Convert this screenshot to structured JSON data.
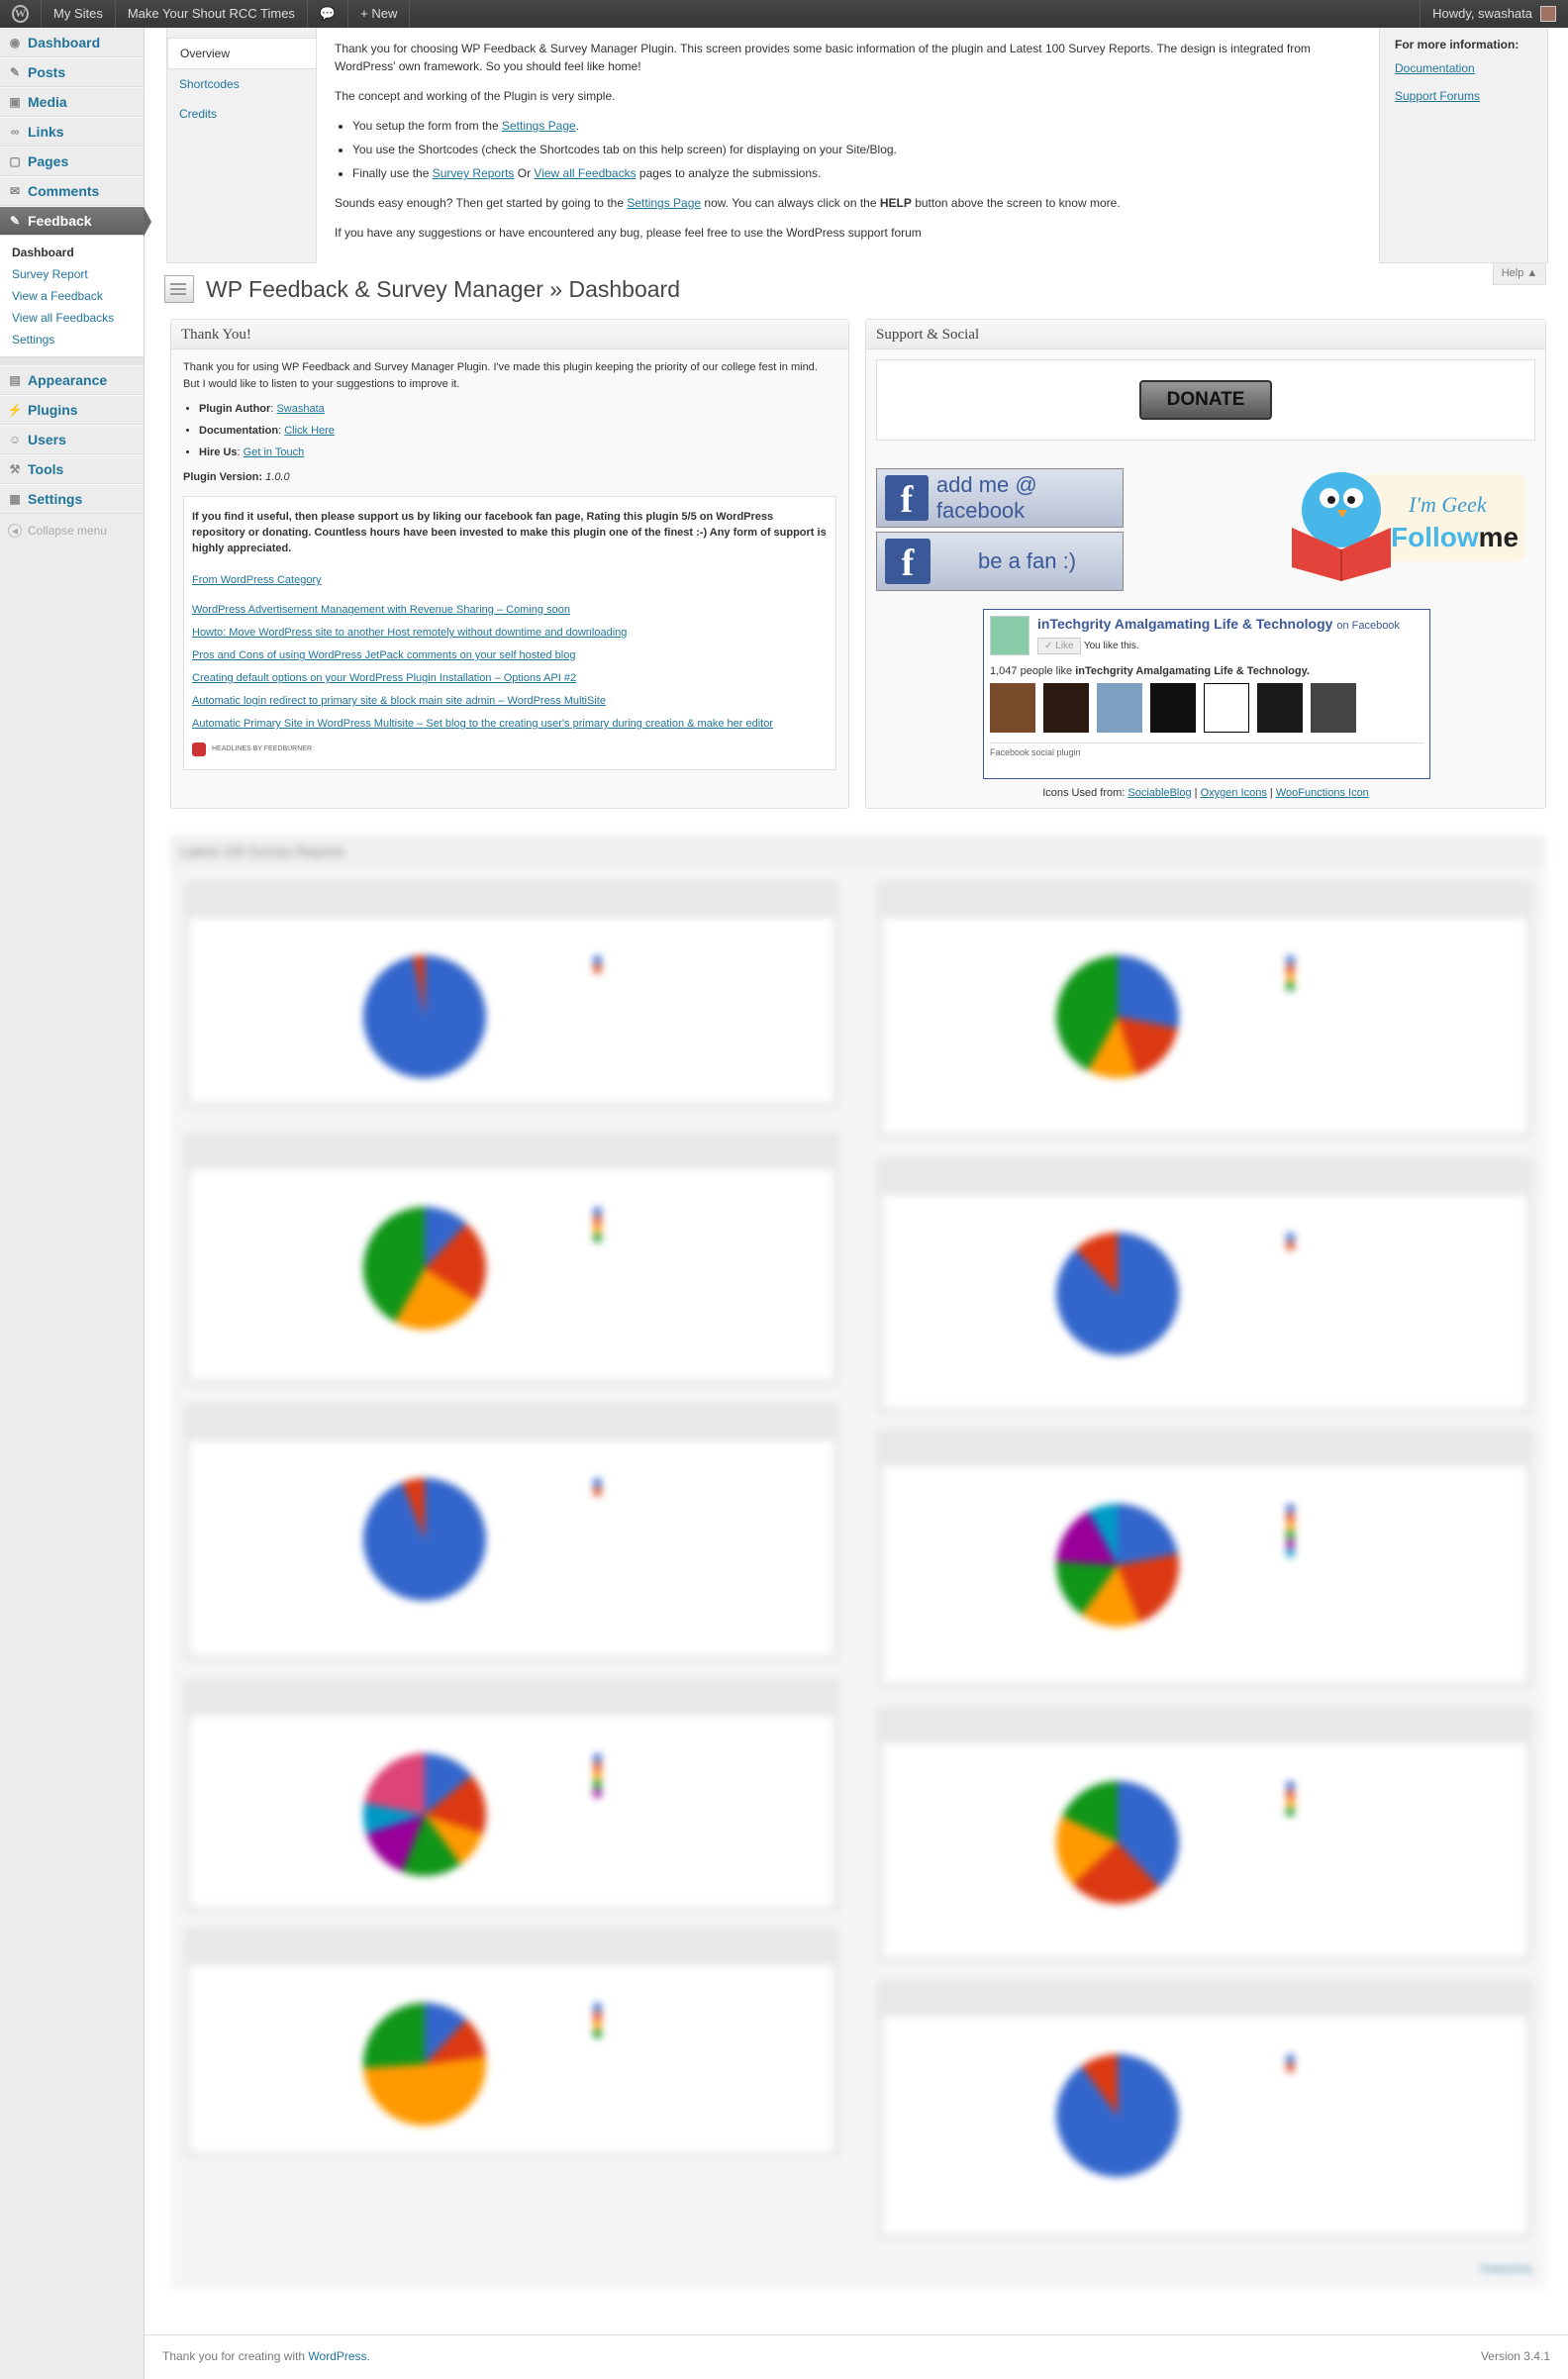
{
  "adminbar": {
    "my_sites": "My Sites",
    "site": "Make Your Shout RCC Times",
    "new": "New",
    "howdy": "Howdy, swashata"
  },
  "menu": {
    "items_top": [
      {
        "label": "Dashboard",
        "icon": "dashboard-icon"
      },
      {
        "label": "Posts",
        "icon": "pin-icon"
      },
      {
        "label": "Media",
        "icon": "media-icon"
      },
      {
        "label": "Links",
        "icon": "link-icon"
      },
      {
        "label": "Pages",
        "icon": "page-icon"
      },
      {
        "label": "Comments",
        "icon": "comment-icon"
      }
    ],
    "active": "Feedback",
    "submenu": [
      "Dashboard",
      "Survey Report",
      "View a Feedback",
      "View all Feedbacks",
      "Settings"
    ],
    "items_bottom": [
      {
        "label": "Appearance"
      },
      {
        "label": "Plugins"
      },
      {
        "label": "Users"
      },
      {
        "label": "Tools"
      },
      {
        "label": "Settings"
      }
    ],
    "collapse": "Collapse menu"
  },
  "help": {
    "tabs": [
      "Overview",
      "Shortcodes",
      "Credits"
    ],
    "p1": "Thank you for choosing WP Feedback & Survey Manager Plugin. This screen provides some basic information of the plugin and Latest 100 Survey Reports. The design is integrated from WordPress' own framework. So you should feel like home!",
    "p2": "The concept and working of the Plugin is very simple.",
    "li1_pre": "You setup the form from the ",
    "li1_link": "Settings Page",
    "li2": "You use the Shortcodes (check the Shortcodes tab on this help screen) for displaying on your Site/Blog.",
    "li3_pre": "Finally use the ",
    "li3_link1": "Survey Reports",
    "li3_mid": " Or ",
    "li3_link2": "View all Feedbacks",
    "li3_post": " pages to analyze the submissions.",
    "p3_pre": "Sounds easy enough? Then get started by going to the ",
    "p3_link": "Settings Page",
    "p3_mid": " now. You can always click on the ",
    "p3_help": "HELP",
    "p3_post": " button above the screen to know more.",
    "p4": "If you have any suggestions or have encountered any bug, please feel free to use the WordPress support forum",
    "side_title": "For more information:",
    "side_links": [
      "Documentation",
      "Support Forums"
    ],
    "button": "Help ▲"
  },
  "page_title": "WP Feedback & Survey Manager » Dashboard",
  "thanks": {
    "title": "Thank You!",
    "intro": "Thank you for using WP Feedback and Survey Manager Plugin. I've made this plugin keeping the priority of our college fest in mind. But I would like to listen to your suggestions to improve it.",
    "author_label": "Plugin Author",
    "author": "Swashata",
    "doc_label": "Documentation",
    "doc": "Click Here",
    "hire_label": "Hire Us",
    "hire": "Get in Touch",
    "version_label": "Plugin Version:",
    "version": "1.0.0",
    "appeal": "If you find it useful, then please support us by liking our facebook fan page, Rating this plugin 5/5 on WordPress repository or donating. Countless hours have been invested to make this plugin one of the finest :-) Any form of support is highly appreciated.",
    "feed_title": "From WordPress Category",
    "feed": [
      "WordPress Advertisement Management with Revenue Sharing – Coming soon",
      "Howto: Move WordPress site to another Host remotely without downtime and downloading",
      "Pros and Cons of using WordPress JetPack comments on your self hosted blog",
      "Creating default options on your WordPress Plugin Installation – Options API #2",
      "Automatic login redirect to primary site & block main site admin – WordPress MultiSite",
      "Automatic Primary Site in WordPress Multisite – Set blog to the creating user's primary during creation & make her editor"
    ],
    "feedburner": "HEADLINES BY FEEDBURNER"
  },
  "support": {
    "title": "Support & Social",
    "donate": "DONATE",
    "fb1": "add me @ facebook",
    "fb2": "be a fan :)",
    "geek": "I'm Geek",
    "follow": "Follow",
    "me": "me",
    "page_name": "inTechgrity Amalgamating Life & Technology",
    "on_fb": "on Facebook",
    "like": "✓ Like",
    "you_like": "You like this.",
    "count_pre": "1,047 people like ",
    "count_name": "inTechgrity Amalgamating Life & Technology.",
    "plugin": "Facebook social plugin",
    "icons_pre": "Icons Used from: ",
    "icons": [
      "SociableBlog",
      "Oxygen Icons",
      "WooFunctions Icon"
    ]
  },
  "survey": {
    "title": "Latest 100 Survey Reports"
  },
  "footer": {
    "thanks_pre": "Thank you for creating with ",
    "wp": "WordPress",
    "version": "Version 3.4.1"
  },
  "colors": {
    "blue": "#3366cc",
    "red": "#dc3912",
    "orange": "#ff9900",
    "green": "#109618",
    "purple": "#990099",
    "cyan": "#0099c6",
    "pink": "#dd4477"
  }
}
